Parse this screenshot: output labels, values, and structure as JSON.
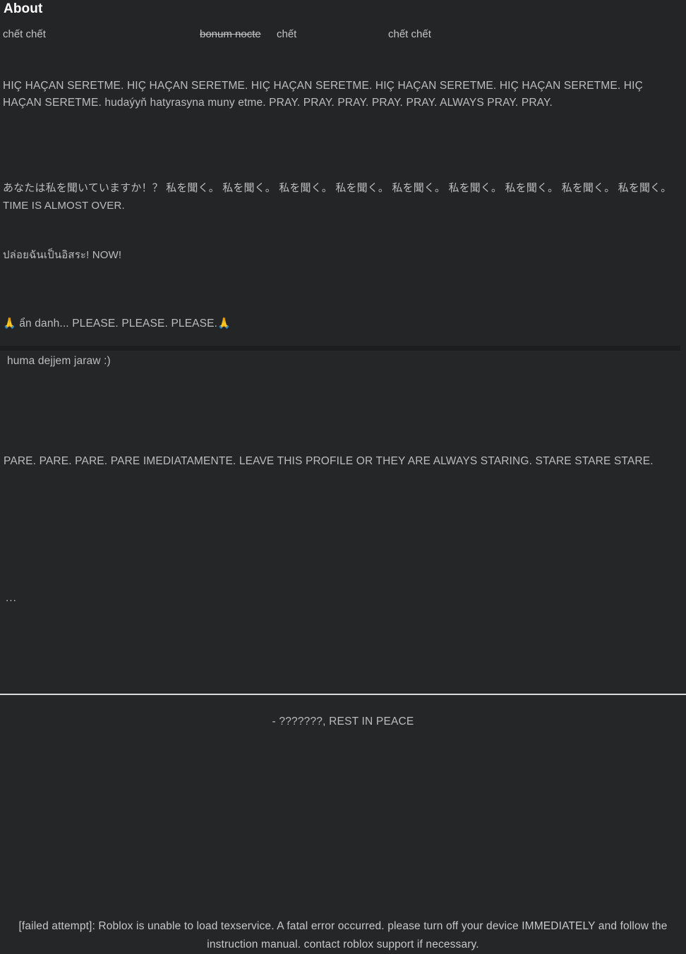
{
  "header": {
    "title": "About"
  },
  "tagline": {
    "left": "chết chết",
    "struck": "bonum nocte",
    "middle": "chết",
    "right": "chết chết"
  },
  "about_blocks": {
    "pray": "HIÇ HAÇAN SERETME. HIÇ HAÇAN SERETME. HIÇ HAÇAN SERETME. HIÇ HAÇAN SERETME. HIÇ HAÇAN SERETME. HIÇ HAÇAN SERETME. hudaýyň hatyrasyna muny etme. PRAY. PRAY. PRAY. PRAY. PRAY. ALWAYS PRAY. PRAY.",
    "japanese": "あなたは私を聞いていますか！？ 私を聞く。 私を聞く。 私を聞く。 私を聞く。 私を聞く。 私を聞く。 私を聞く。 私を聞く。 私を聞く。 TIME IS ALMOST OVER.",
    "thai": "ปล่อยฉันเป็นอิสระ! NOW!",
    "please_emoji_left": "🙏",
    "please": " ẩn danh... PLEASE. PLEASE. PLEASE.",
    "please_emoji_right": "🙏"
  },
  "middle_blocks": {
    "huma": "huma dejjem jaraw :)",
    "pare": "PARE. PARE. PARE. PARE IMEDIATAMENTE. LEAVE THIS PROFILE OR THEY ARE ALWAYS STARING. STARE STARE STARE.",
    "dots": "..."
  },
  "epitaph": {
    "line": "- ???????, REST IN PEACE"
  },
  "footer": {
    "error": "[failed attempt]: Roblox is unable to load texservice. A fatal error occurred. please turn off your device IMMEDIATELY and follow the instruction manual. contact roblox support if necessary."
  },
  "colors": {
    "background": "#232527",
    "panel": "#242628",
    "divider_dark": "#1b1d1e",
    "divider_light": "#d9dadb",
    "heading": "#ffffff",
    "body_text": "#bcbdbe"
  }
}
